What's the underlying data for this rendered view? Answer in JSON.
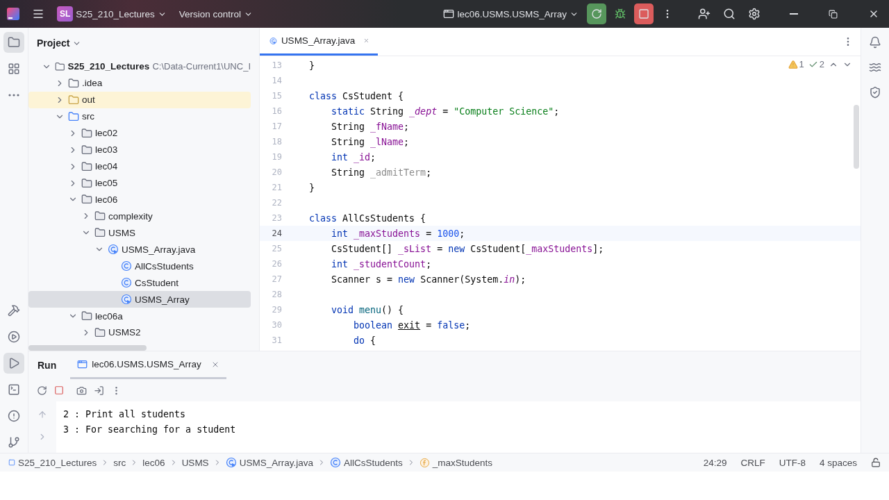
{
  "title_bar": {
    "project_badge": "SL",
    "project": "S25_210_Lectures",
    "vcs": "Version control",
    "run_config": "lec06.USMS.USMS_Array"
  },
  "left_strip": [
    {
      "kind": "project",
      "selected": true
    },
    {
      "kind": "structure",
      "selected": false
    },
    {
      "kind": "more",
      "selected": false
    },
    {
      "kind": "build",
      "selected": false
    },
    {
      "kind": "services",
      "selected": false
    },
    {
      "kind": "run",
      "selected": true
    },
    {
      "kind": "terminal",
      "selected": false
    },
    {
      "kind": "problems",
      "selected": false
    },
    {
      "kind": "git",
      "selected": false
    }
  ],
  "project_panel": {
    "title": "Project",
    "tree": [
      {
        "label": "S25_210_Lectures",
        "path": "C:\\Data-Current1\\UNC_I",
        "kind": "project",
        "expanded": true,
        "selected": false,
        "children": [
          {
            "label": ".idea",
            "kind": "folder",
            "expanded": false,
            "selected": false
          },
          {
            "label": "out",
            "kind": "excluded-folder",
            "expanded": false,
            "selected": false
          },
          {
            "label": "src",
            "kind": "source-folder",
            "expanded": true,
            "selected": false,
            "children": [
              {
                "label": "lec02",
                "kind": "package",
                "expanded": false,
                "selected": false
              },
              {
                "label": "lec03",
                "kind": "package",
                "expanded": false,
                "selected": false
              },
              {
                "label": "lec04",
                "kind": "package",
                "expanded": false,
                "selected": false
              },
              {
                "label": "lec05",
                "kind": "package",
                "expanded": false,
                "selected": false
              },
              {
                "label": "lec06",
                "kind": "package",
                "expanded": true,
                "selected": false,
                "children": [
                  {
                    "label": "complexity",
                    "kind": "package",
                    "expanded": false,
                    "selected": false
                  },
                  {
                    "label": "USMS",
                    "kind": "package",
                    "expanded": true,
                    "selected": false,
                    "children": [
                      {
                        "label": "USMS_Array.java",
                        "kind": "java-file",
                        "expanded": true,
                        "selected": false,
                        "children": [
                          {
                            "label": "AllCsStudents",
                            "kind": "class",
                            "selected": false
                          },
                          {
                            "label": "CsStudent",
                            "kind": "class",
                            "selected": false
                          },
                          {
                            "label": "USMS_Array",
                            "kind": "main-class",
                            "selected": true
                          }
                        ]
                      }
                    ]
                  }
                ]
              },
              {
                "label": "lec06a",
                "kind": "package",
                "expanded": true,
                "selected": false,
                "children": [
                  {
                    "label": "USMS2",
                    "kind": "package",
                    "expanded": false,
                    "selected": false
                  }
                ]
              }
            ]
          }
        ]
      }
    ]
  },
  "editor": {
    "tabs": [
      {
        "label": "USMS_Array.java",
        "selected": true
      }
    ],
    "inspections": {
      "warnings": "1",
      "weak_warnings": "2"
    },
    "lines": [
      {
        "n": "13",
        "current": false,
        "tokens": [
          {
            "kind": "plain",
            "text": "}"
          }
        ]
      },
      {
        "n": "14",
        "current": false
      },
      {
        "n": "15",
        "current": false,
        "tokens": [
          {
            "kind": "kw",
            "text": "class"
          },
          {
            "kind": "plain",
            "text": " CsStudent {"
          }
        ]
      },
      {
        "n": "16",
        "current": false,
        "tokens": [
          {
            "kind": "kw",
            "text": "    static"
          },
          {
            "kind": "plain",
            "text": " String "
          },
          {
            "kind": "static",
            "text": "_dept"
          },
          {
            "kind": "plain",
            "text": " = "
          },
          {
            "kind": "string",
            "text": "\"Computer Science\""
          },
          {
            "kind": "plain",
            "text": ";"
          }
        ]
      },
      {
        "n": "17",
        "current": false,
        "tokens": [
          {
            "kind": "plain",
            "text": "    String "
          },
          {
            "kind": "field",
            "text": "_fName"
          },
          {
            "kind": "plain",
            "text": ";"
          }
        ]
      },
      {
        "n": "18",
        "current": false,
        "tokens": [
          {
            "kind": "plain",
            "text": "    String "
          },
          {
            "kind": "field",
            "text": "_lName"
          },
          {
            "kind": "plain",
            "text": ";"
          }
        ]
      },
      {
        "n": "19",
        "current": false,
        "tokens": [
          {
            "kind": "kw",
            "text": "    int"
          },
          {
            "kind": "field",
            "text": " _id"
          },
          {
            "kind": "plain",
            "text": ";"
          }
        ]
      },
      {
        "n": "20",
        "current": false,
        "tokens": [
          {
            "kind": "plain",
            "text": "    String "
          },
          {
            "kind": "unused",
            "text": "_admitTerm"
          },
          {
            "kind": "plain",
            "text": ";"
          }
        ]
      },
      {
        "n": "21",
        "current": false,
        "tokens": [
          {
            "kind": "plain",
            "text": "}"
          }
        ]
      },
      {
        "n": "22",
        "current": false
      },
      {
        "n": "23",
        "current": false,
        "tokens": [
          {
            "kind": "kw",
            "text": "class"
          },
          {
            "kind": "plain",
            "text": " AllCsStudents {"
          }
        ]
      },
      {
        "n": "24",
        "current": true,
        "tokens": [
          {
            "kind": "kw",
            "text": "    int"
          },
          {
            "kind": "field",
            "text": " _maxStudents"
          },
          {
            "kind": "plain",
            "text": " = "
          },
          {
            "kind": "number",
            "text": "1000"
          },
          {
            "kind": "plain",
            "text": ";"
          }
        ]
      },
      {
        "n": "25",
        "current": false,
        "tokens": [
          {
            "kind": "plain",
            "text": "    CsStudent[] "
          },
          {
            "kind": "field",
            "text": "_sList"
          },
          {
            "kind": "plain",
            "text": " = "
          },
          {
            "kind": "kw",
            "text": "new"
          },
          {
            "kind": "plain",
            "text": " CsStudent["
          },
          {
            "kind": "field",
            "text": "_maxStudents"
          },
          {
            "kind": "plain",
            "text": "];"
          }
        ]
      },
      {
        "n": "26",
        "current": false,
        "tokens": [
          {
            "kind": "kw",
            "text": "    int"
          },
          {
            "kind": "field",
            "text": " _studentCount"
          },
          {
            "kind": "plain",
            "text": ";"
          }
        ]
      },
      {
        "n": "27",
        "current": false,
        "tokens": [
          {
            "kind": "plain",
            "text": "    Scanner s = "
          },
          {
            "kind": "kw",
            "text": "new"
          },
          {
            "kind": "plain",
            "text": " Scanner(System."
          },
          {
            "kind": "static",
            "text": "in"
          },
          {
            "kind": "plain",
            "text": ");"
          }
        ]
      },
      {
        "n": "28",
        "current": false
      },
      {
        "n": "29",
        "current": false,
        "tokens": [
          {
            "kind": "kw",
            "text": "    void"
          },
          {
            "kind": "method",
            "text": " menu"
          },
          {
            "kind": "plain",
            "text": "() {"
          }
        ]
      },
      {
        "n": "30",
        "current": false,
        "tokens": [
          {
            "kind": "kw",
            "text": "        boolean "
          },
          {
            "kind": "reassigned",
            "text": "exit"
          },
          {
            "kind": "plain",
            "text": " = "
          },
          {
            "kind": "kw",
            "text": "false"
          },
          {
            "kind": "plain",
            "text": ";"
          }
        ]
      },
      {
        "n": "31",
        "current": false,
        "tokens": [
          {
            "kind": "kw",
            "text": "        do"
          },
          {
            "kind": "plain",
            "text": " {"
          }
        ]
      }
    ]
  },
  "run_panel": {
    "title": "Run",
    "tabs": [
      {
        "label": "lec06.USMS.USMS_Array",
        "selected": true
      }
    ],
    "console": [
      "2 : Print all students",
      "3 : For searching for a student"
    ]
  },
  "status_bar": {
    "breadcrumbs": [
      {
        "label": "S25_210_Lectures",
        "kind": "module"
      },
      {
        "label": "src",
        "kind": "plain"
      },
      {
        "label": "lec06",
        "kind": "plain"
      },
      {
        "label": "USMS",
        "kind": "plain"
      },
      {
        "label": "USMS_Array.java",
        "kind": "java-file"
      },
      {
        "label": "AllCsStudents",
        "kind": "class"
      },
      {
        "label": "_maxStudents",
        "kind": "field"
      }
    ],
    "items": [
      "24:29",
      "CRLF",
      "UTF-8",
      "4 spaces"
    ]
  }
}
